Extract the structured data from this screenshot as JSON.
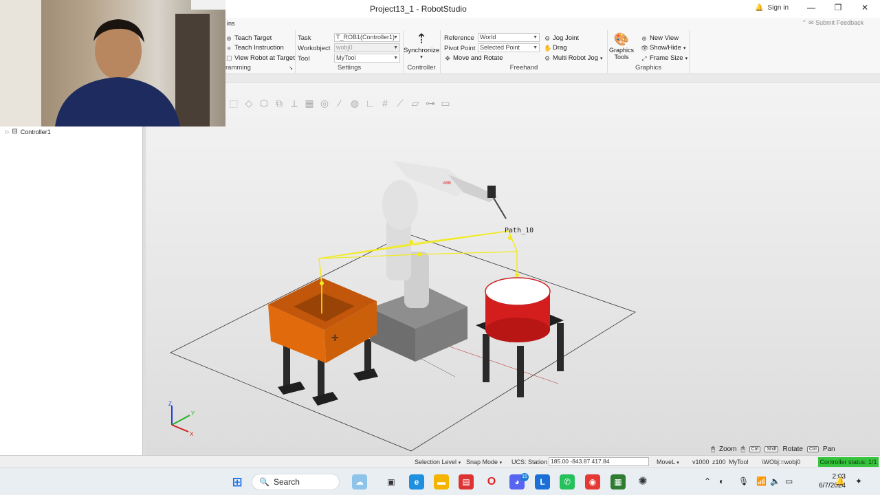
{
  "window": {
    "title": "Project13_1 - RobotStudio",
    "sign_in": "Sign in",
    "minimize": "—",
    "restore": "❐",
    "close": "✕"
  },
  "ribbon": {
    "tab_fragment": "ins",
    "submit_feedback": "Submit Feedback",
    "programming": {
      "label": "ramming",
      "teach_target": "Teach Target",
      "teach_instruction": "Teach Instruction",
      "view_robot_at_target": "View Robot at Target"
    },
    "settings": {
      "label": "Settings",
      "task_label": "Task",
      "task_value": "T_ROB1(Controller1)",
      "workobject_label": "Workobject",
      "workobject_value": "wobj0",
      "tool_label": "Tool",
      "tool_value": "MyTool"
    },
    "controller": {
      "label": "Controller",
      "synchronize": "Synchronize"
    },
    "freehand": {
      "label": "Freehand",
      "reference_label": "Reference",
      "reference_value": "World",
      "pivot_label": "Pivot Point",
      "pivot_value": "Selected Point",
      "move_and_rotate": "Move and Rotate",
      "jog_joint": "Jog Joint",
      "drag": "Drag",
      "multi_robot_jog": "Multi Robot Jog"
    },
    "graphics": {
      "label": "Graphics",
      "graphics_tools": "Graphics Tools",
      "new_view": "New View",
      "show_hide": "Show/Hide",
      "frame_size": "Frame Size"
    }
  },
  "tree": {
    "controller": "Controller1"
  },
  "viewport": {
    "path_label": "Path_10",
    "brand": "ABB",
    "axis_x": "X",
    "axis_y": "Y",
    "axis_z": "Z",
    "nav": {
      "zoom": "Zoom",
      "rotate": "Rotate",
      "pan": "Pan",
      "ctrl": "Ctrl",
      "shift": "Shift"
    }
  },
  "statusbar": {
    "selection_level": "Selection Level",
    "snap_mode": "Snap Mode",
    "ucs": "UCS: Station",
    "coordinates": "185.00  -843.87  417.84",
    "motion": "MoveL",
    "speed": "v1000",
    "zone": "z100",
    "tool": "MyTool",
    "wobj": "\\WObj:=wobj0",
    "controller_status": "Controller status: 1/1",
    "colors": {
      "status_ok": "#35c43b"
    }
  },
  "taskbar": {
    "search": "Search",
    "badge_count": "15",
    "time": "2:03",
    "date": "6/7/2024"
  }
}
